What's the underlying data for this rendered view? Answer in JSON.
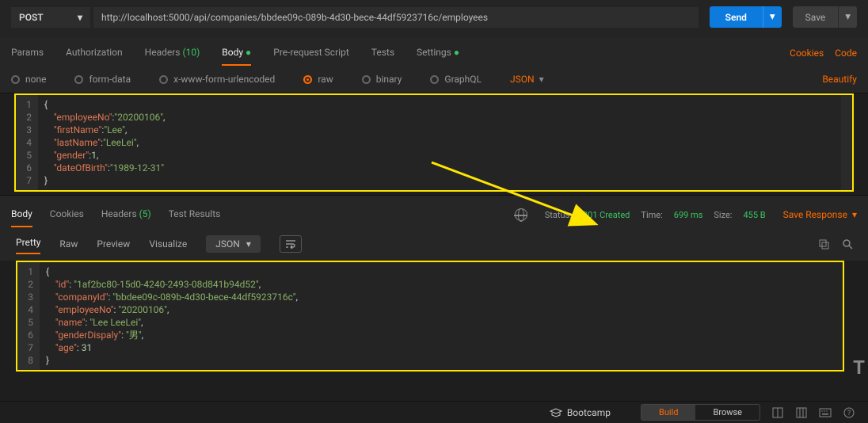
{
  "topbar": {
    "method": "POST",
    "url": "http://localhost:5000/api/companies/bbdee09c-089b-4d30-bece-44df5923716c/employees",
    "send": "Send",
    "save": "Save"
  },
  "tabs": {
    "params": "Params",
    "auth": "Authorization",
    "headers": "Headers",
    "headers_count": "(10)",
    "body": "Body",
    "prescript": "Pre-request Script",
    "tests": "Tests",
    "settings": "Settings",
    "cookies": "Cookies",
    "code": "Code"
  },
  "content_type": {
    "none": "none",
    "formdata": "form-data",
    "urlencoded": "x-www-form-urlencoded",
    "raw": "raw",
    "binary": "binary",
    "graphql": "GraphQL",
    "json": "JSON",
    "beautify": "Beautify"
  },
  "request_body": {
    "lines": [
      "1",
      "2",
      "3",
      "4",
      "5",
      "6",
      "7"
    ],
    "json": {
      "employeeNo": "20200106",
      "firstName": "Lee",
      "lastName": "LeeLei",
      "gender": 1,
      "dateOfBirth": "1989-12-31"
    }
  },
  "response_tabs": {
    "body": "Body",
    "cookies": "Cookies",
    "headers": "Headers",
    "headers_count": "(5)",
    "tests": "Test Results",
    "save_response": "Save Response"
  },
  "status": {
    "status_label": "Status:",
    "status_value": "201 Created",
    "time_label": "Time:",
    "time_value": "699 ms",
    "size_label": "Size:",
    "size_value": "455 B"
  },
  "view": {
    "pretty": "Pretty",
    "raw": "Raw",
    "preview": "Preview",
    "visualize": "Visualize",
    "format": "JSON"
  },
  "response_body": {
    "lines": [
      "1",
      "2",
      "3",
      "4",
      "5",
      "6",
      "7",
      "8"
    ],
    "json": {
      "id": "1af2bc80-15d0-4240-2493-08d841b94d52",
      "companyId": "bbdee09c-089b-4d30-bece-44df5923716c",
      "employeeNo": "20200106",
      "name": "Lee LeeLei",
      "genderDispaly": "男",
      "age": 31
    }
  },
  "footer": {
    "bootcamp": "Bootcamp",
    "build": "Build",
    "browse": "Browse"
  }
}
